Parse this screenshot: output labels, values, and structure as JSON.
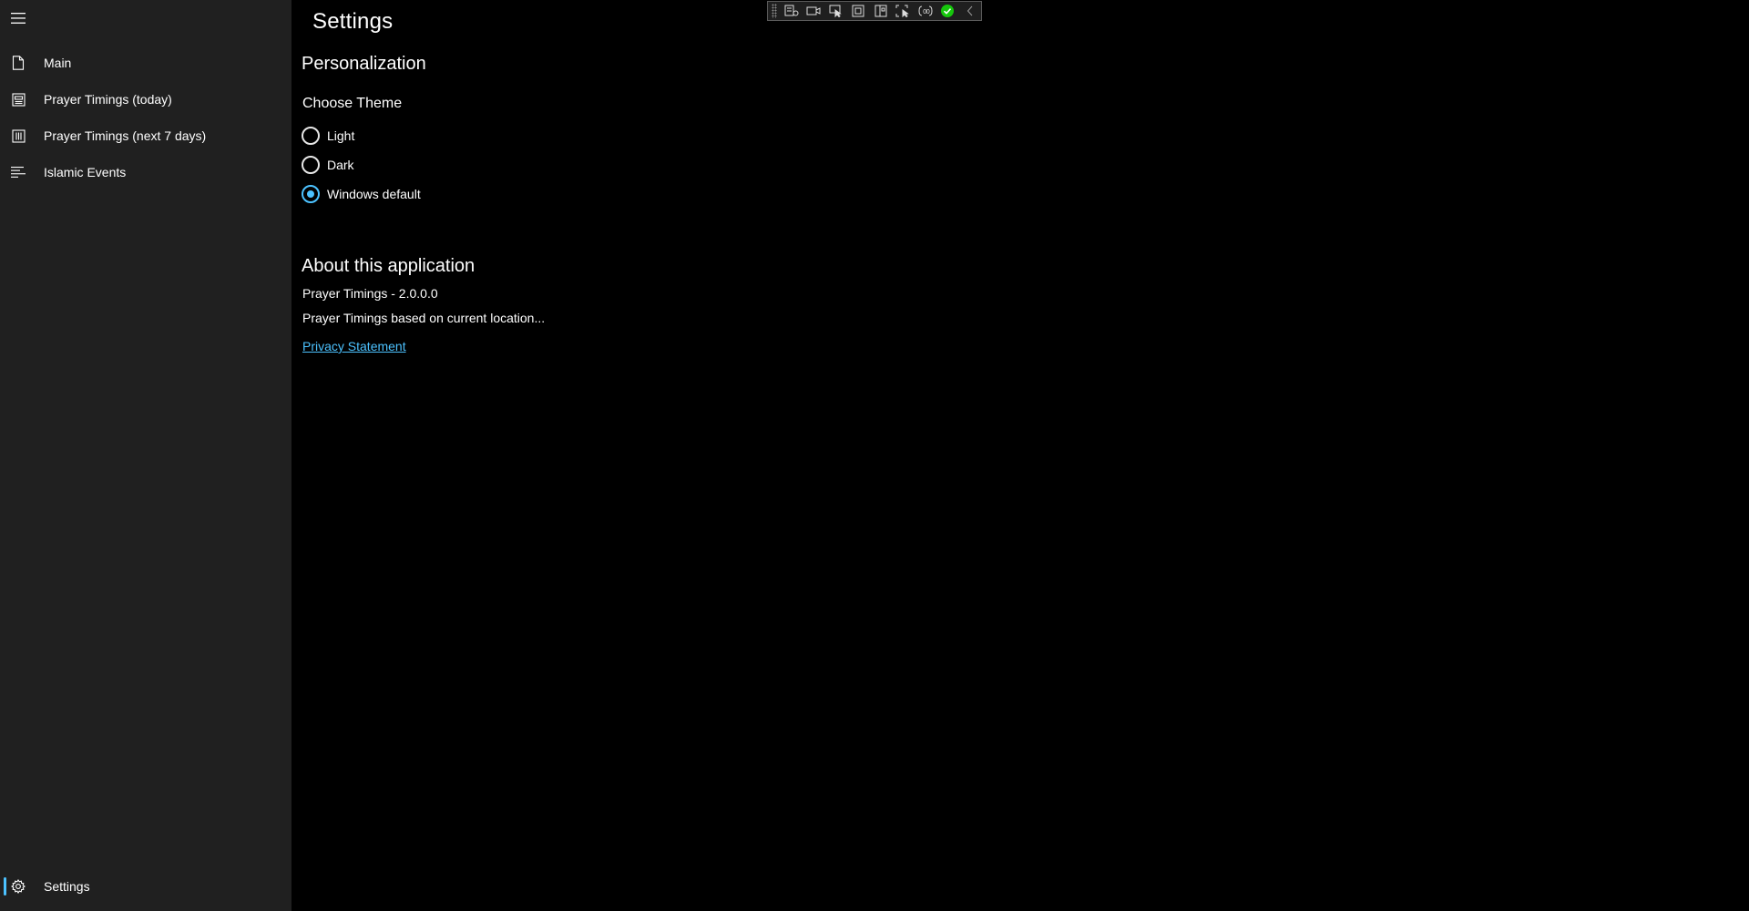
{
  "sidebar": {
    "items": [
      {
        "label": "Main",
        "icon": "document-icon"
      },
      {
        "label": "Prayer Timings (today)",
        "icon": "today-icon"
      },
      {
        "label": "Prayer Timings (next 7 days)",
        "icon": "calendar-week-icon"
      },
      {
        "label": "Islamic Events",
        "icon": "list-icon"
      }
    ],
    "footer_item": {
      "label": "Settings",
      "icon": "gear-icon",
      "selected": true
    }
  },
  "page": {
    "title": "Settings"
  },
  "personalization": {
    "title": "Personalization",
    "choose_theme": "Choose Theme",
    "options": [
      {
        "label": "Light",
        "checked": false
      },
      {
        "label": "Dark",
        "checked": false
      },
      {
        "label": "Windows default",
        "checked": true
      }
    ]
  },
  "about": {
    "title": "About this application",
    "version_line": "Prayer Timings - 2.0.0.0",
    "description": "Prayer Timings based on current location...",
    "privacy_link": "Privacy Statement"
  },
  "toolbar": {
    "icons": [
      "live-tree-icon",
      "record-icon",
      "select-element-icon",
      "layout-adorner-icon",
      "display-layout-icon",
      "track-focus-icon",
      "binding-failures-icon",
      "accessibility-check-icon",
      "collapse-icon"
    ]
  },
  "colors": {
    "accent": "#4cc2ff",
    "sidebar_bg": "#202020",
    "content_bg": "#000000"
  }
}
